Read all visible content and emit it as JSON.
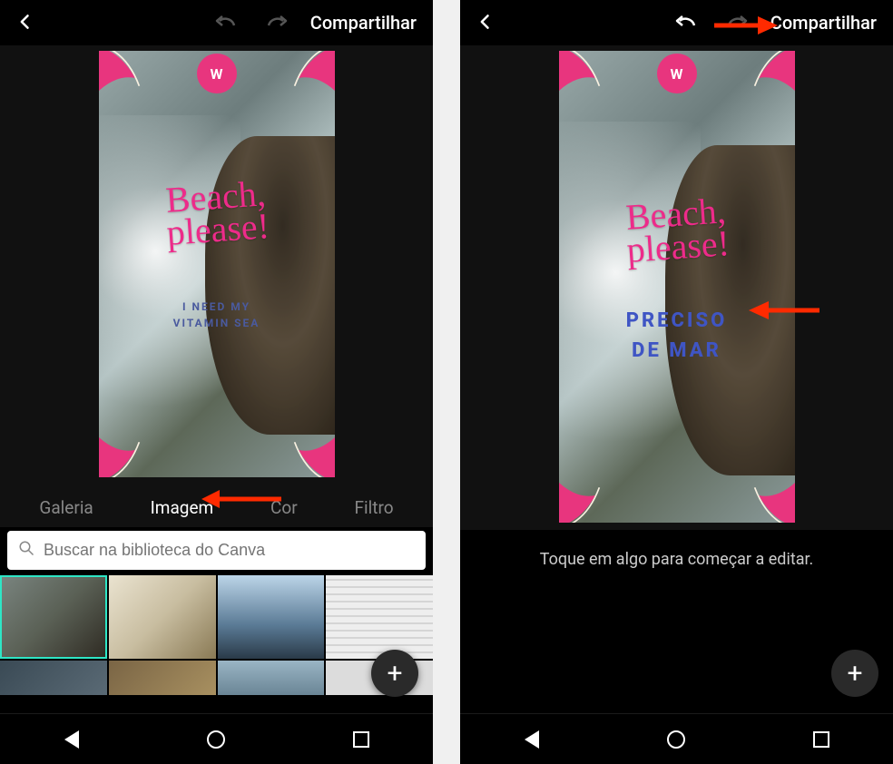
{
  "header": {
    "share_label": "Compartilhar"
  },
  "canvas": {
    "script_line1": "Beach,",
    "script_line2": "please!",
    "sub_line1_left": "I NEED MY",
    "sub_line2_left": "VITAMIN SEA",
    "sub_line1_right": "PRECISO",
    "sub_line2_right": "DE MAR",
    "logo_text": "W"
  },
  "tabs": {
    "galeria": "Galeria",
    "imagem": "Imagem",
    "cor": "Cor",
    "filtro": "Filtro"
  },
  "search": {
    "placeholder": "Buscar na biblioteca do Canva"
  },
  "hint": {
    "text": "Toque em algo para começar a editar."
  },
  "fab": {
    "plus": "+"
  }
}
